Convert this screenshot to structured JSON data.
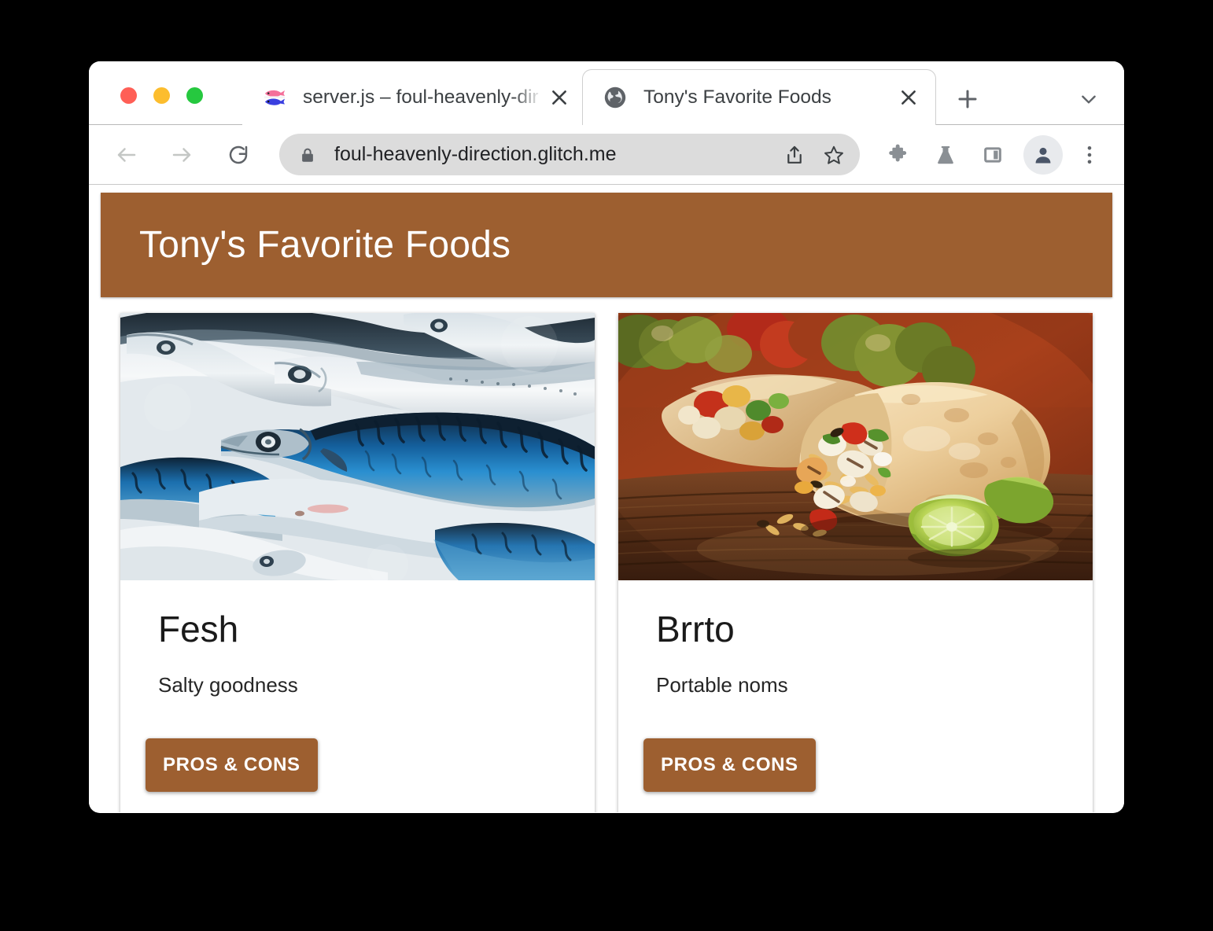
{
  "window": {
    "traffic_lights": [
      "close",
      "minimize",
      "maximize"
    ],
    "colors": {
      "close": "#ff5f56",
      "minimize": "#fcbd2e",
      "maximize": "#26c83f"
    }
  },
  "tabstrip": {
    "tabs": [
      {
        "title": "server.js – foul-heavenly-dir",
        "favicon": "fish-flag-icon",
        "active": false,
        "close_label": "close-tab"
      },
      {
        "title": "Tony's Favorite Foods",
        "favicon": "globe-icon",
        "active": true,
        "close_label": "close-tab"
      }
    ],
    "new_tab_label": "+",
    "tab_list_label": "chevron-down"
  },
  "toolbar": {
    "back_label": "Back",
    "forward_label": "Forward",
    "reload_label": "Reload",
    "url": "foul-heavenly-direction.glitch.me",
    "url_placeholder": "Search Google or type a URL",
    "security": "secure-lock",
    "share_label": "Share",
    "bookmark_label": "Bookmark this tab",
    "extensions_label": "Extensions",
    "labs_label": "Chrome Labs",
    "side_panel_label": "Side panel",
    "profile_label": "Profile",
    "menu_label": "Customize and control Google Chrome"
  },
  "page": {
    "title": "Tony's Favorite Foods",
    "accent_color": "#9d5f30",
    "header_text_color": "#ffffff",
    "cards": [
      {
        "heading": "Fesh",
        "text": "Salty goodness",
        "button_label": "PROS & CONS",
        "image_alt": "fresh-mackerel-fish-photo"
      },
      {
        "heading": "Brrto",
        "text": "Portable noms",
        "button_label": "PROS & CONS",
        "image_alt": "chicken-burrito-with-lime-photo"
      }
    ]
  }
}
